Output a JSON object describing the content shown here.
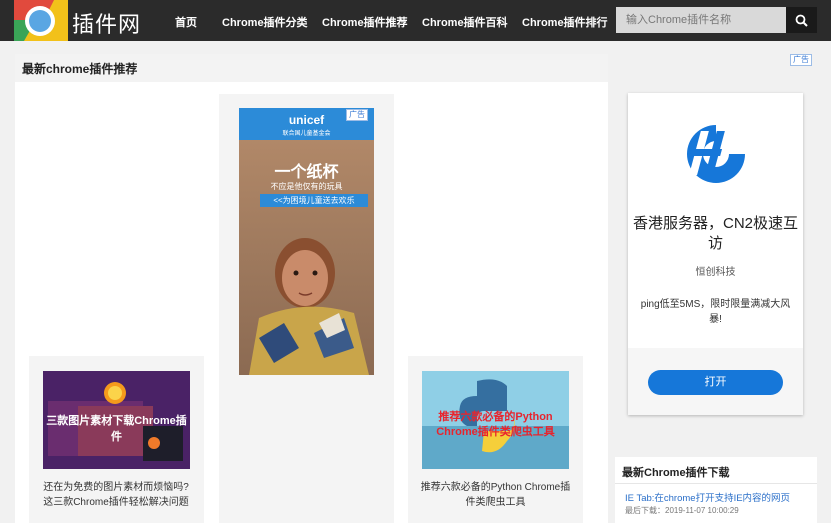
{
  "header": {
    "logo_text": "插件网",
    "nav": [
      "首页",
      "Chrome插件分类",
      "Chrome插件推荐",
      "Chrome插件百科",
      "Chrome插件排行"
    ],
    "search_placeholder": "输入Chrome插件名称",
    "search_icon": "search-icon"
  },
  "main": {
    "title": "最新chrome插件推荐",
    "ad": {
      "brand": "unicef",
      "brand_sub": "联合国儿童基金会",
      "badge": "广告",
      "headline": "一个纸杯",
      "line2": "不应是他仅有的玩具",
      "cta": "<<为困境儿童送去欢乐"
    },
    "cards": [
      {
        "thumb_text": "三款图片素材下载Chrome插件",
        "caption": "还在为免费的图片素材而烦恼吗?这三款Chrome插件轻松解决问题"
      },
      {
        "thumb_text": "推荐六款必备的Python Chrome插件类爬虫工具",
        "caption": "推荐六款必备的Python Chrome插件类爬虫工具"
      }
    ]
  },
  "side_ad": {
    "badge": "广告",
    "title": "香港服务器，CN2极速互访",
    "company": "恒创科技",
    "desc": "ping低至5MS，限时限量满减大风暴!",
    "button": "打开",
    "brand_color": "#1677d9"
  },
  "downloads": {
    "title": "最新Chrome插件下载",
    "items": [
      {
        "title": "IE Tab:在chrome打开支持IE内容的网页",
        "meta": "最后下载：2019-11-07 10:00:29"
      }
    ]
  }
}
